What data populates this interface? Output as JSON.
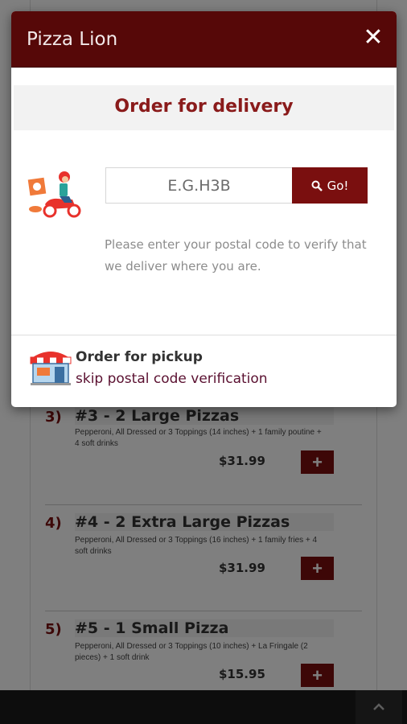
{
  "modal": {
    "title": "Pizza Lion",
    "close_glyph": "✕",
    "delivery_heading": "Order for delivery",
    "postal_placeholder": "E.G.H3B",
    "go_label": "Go!",
    "hint": "Please enter your postal code to verify that we deliver where you are.",
    "pickup_title": "Order for pickup",
    "pickup_link": "skip postal code verification"
  },
  "menu": {
    "items": [
      {
        "num": "3)",
        "title": "#3 - 2 Large Pizzas",
        "desc": "Pepperoni, All Dressed or 3 Toppings (14 inches) + 1 family poutine + 4 soft drinks",
        "price": "$31.99"
      },
      {
        "num": "4)",
        "title": "#4 - 2 Extra Large Pizzas",
        "desc": "Pepperoni, All Dressed or 3 Toppings (16 inches) + 1 family fries + 4 soft drinks",
        "price": "$31.99"
      },
      {
        "num": "5)",
        "title": "#5 - 1 Small Pizza",
        "desc": "Pepperoni, All Dressed or 3 Toppings (10 inches) + La Fringale (2 pieces) + 1 soft drink",
        "price": "$15.95"
      }
    ],
    "add_glyph": "+"
  },
  "footer": {
    "scroll_top_icon": "chevron-up-icon"
  },
  "colors": {
    "brand_dark": "#560808",
    "button": "#7a0f0f",
    "heading": "#8a1b1b"
  }
}
